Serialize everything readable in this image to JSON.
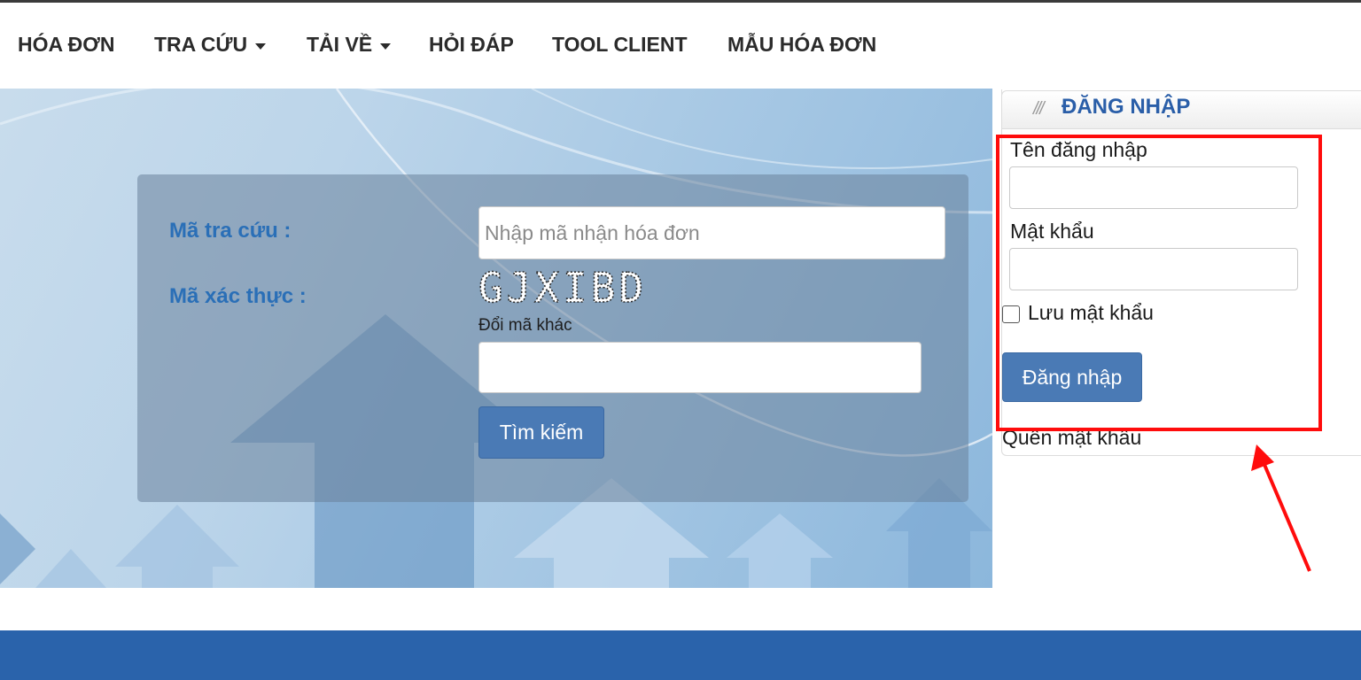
{
  "nav": {
    "items": [
      {
        "label": "HÓA ĐƠN",
        "dropdown": false
      },
      {
        "label": "TRA CỨU",
        "dropdown": true
      },
      {
        "label": "TẢI VỀ",
        "dropdown": true
      },
      {
        "label": "HỎI ĐÁP",
        "dropdown": false
      },
      {
        "label": "TOOL CLIENT",
        "dropdown": false
      },
      {
        "label": "MẪU HÓA ĐƠN",
        "dropdown": false
      }
    ]
  },
  "search": {
    "lookup_label": "Mã tra cứu :",
    "lookup_placeholder": "Nhập mã nhận hóa đơn",
    "captcha_label": "Mã xác thực :",
    "captcha_text": "GJXIBD",
    "change_code": "Đổi mã khác",
    "captcha_value": "",
    "search_button": "Tìm kiếm"
  },
  "login": {
    "title": "ĐĂNG NHẬP",
    "username_label": "Tên đăng nhập",
    "username_value": "",
    "password_label": "Mật khẩu",
    "password_value": "",
    "remember_label": "Lưu mật khẩu",
    "remember_checked": false,
    "login_button": "Đăng nhập",
    "forgot_label": "Quên mật khẩu"
  },
  "colors": {
    "accent_blue": "#2a6fb7",
    "button_blue": "#4a7ab5",
    "footer_blue": "#2a63ab",
    "highlight_red": "#ff0c0c"
  }
}
